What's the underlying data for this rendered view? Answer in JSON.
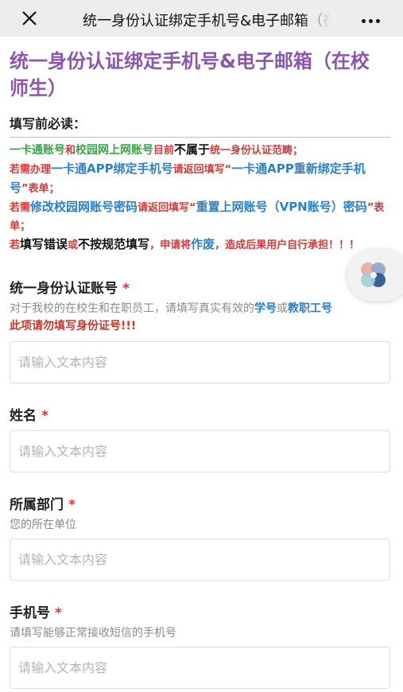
{
  "topbar": {
    "title": "统一身份认证绑定手机号&电子邮箱（在校师生）"
  },
  "page": {
    "title_line1": "统一身份认证绑定手机号&电子邮箱（在校",
    "title_line2": "师生）",
    "notice_heading": "填写前必读："
  },
  "notice": {
    "l1": {
      "a": "一卡通账号",
      "b": "和",
      "c": "校园网上网账号",
      "d": "目前",
      "e": "不属于",
      "f": "统一身份认证范畴；"
    },
    "l2": {
      "a": "若需办理",
      "b": "一卡通APP绑定手机号",
      "c": "请返回填写“",
      "d": "一卡通APP重新绑定手机号",
      "e": "”表单；"
    },
    "l3": {
      "a": "若需",
      "b": "修改校园网账号密码",
      "c": "请返回填写“",
      "d": "重置上网账号（VPN账号）密码",
      "e": "”表单；"
    },
    "l4": {
      "a": "若",
      "b": "填写错误",
      "c": "或",
      "d": "不按规范填写",
      "e": "，",
      "f": "申请将",
      "g": "作废",
      "h": "，造成后果用户自行承担！！！"
    }
  },
  "fields": {
    "account": {
      "label": "统一身份认证账号",
      "required": "*",
      "desc_a": "对于我校的在校生和在职员工，请填写真实有效的",
      "desc_b": "学号",
      "desc_c": "或",
      "desc_d": "教职工号",
      "desc_warn": "此项请勿填写身份证号!!!",
      "placeholder": "请输入文本内容"
    },
    "name": {
      "label": "姓名",
      "required": "*",
      "placeholder": "请输入文本内容"
    },
    "department": {
      "label": "所属部门",
      "required": "*",
      "desc": "您的所在单位",
      "placeholder": "请输入文本内容"
    },
    "phone": {
      "label": "手机号",
      "required": "*",
      "desc": "请填写能够正常接收短信的手机号",
      "placeholder": "请输入文本内容"
    }
  },
  "colors": {
    "title_purple": "#8e55ad",
    "green": "#3aa34a",
    "red": "#d23a3a",
    "blue": "#2d7fc6"
  },
  "icons": [
    "close-icon",
    "more-icon",
    "assistant-icon"
  ]
}
